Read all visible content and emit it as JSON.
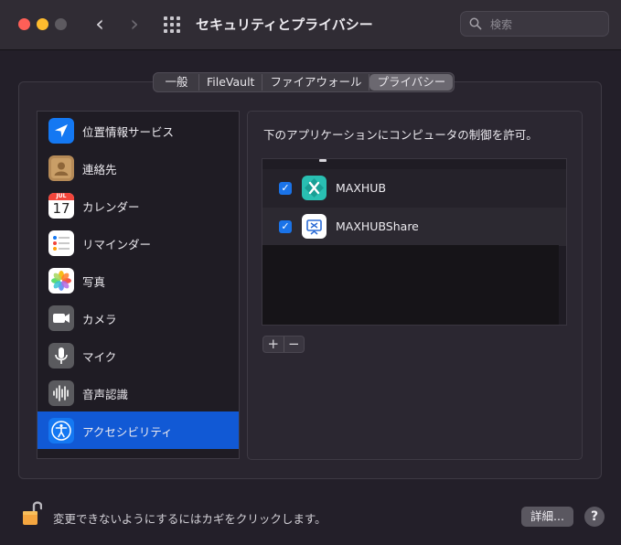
{
  "window": {
    "title": "セキュリティとプライバシー",
    "search_placeholder": "検索"
  },
  "tabs": [
    "一般",
    "FileVault",
    "ファイアウォール",
    "プライバシー"
  ],
  "active_tab": "プライバシー",
  "sidebar": {
    "items": [
      {
        "label": "位置情報サービス",
        "icon": "location-arrow-icon"
      },
      {
        "label": "連絡先",
        "icon": "contacts-icon"
      },
      {
        "label": "カレンダー",
        "icon": "calendar-icon",
        "icon_month": "JUL",
        "icon_day": "17"
      },
      {
        "label": "リマインダー",
        "icon": "reminders-icon"
      },
      {
        "label": "写真",
        "icon": "photos-icon"
      },
      {
        "label": "カメラ",
        "icon": "camera-icon"
      },
      {
        "label": "マイク",
        "icon": "microphone-icon"
      },
      {
        "label": "音声認識",
        "icon": "speech-recognition-icon"
      },
      {
        "label": "アクセシビリティ",
        "icon": "accessibility-icon",
        "selected": true
      }
    ]
  },
  "right_panel": {
    "heading": "下のアプリケーションにコンピュータの制御を許可。",
    "apps": [
      {
        "name": "MAXHUB",
        "checked": true,
        "icon": "maxhub-icon"
      },
      {
        "name": "MAXHUBShare",
        "checked": true,
        "icon": "maxhub-share-icon"
      }
    ],
    "add_label": "+",
    "remove_label": "−"
  },
  "footer": {
    "lock_text": "変更できないようにするにはカギをクリックします。",
    "details_button": "詳細...",
    "help_button": "?"
  },
  "colors": {
    "selection": "#1159d5",
    "checkbox": "#1a73e8"
  }
}
